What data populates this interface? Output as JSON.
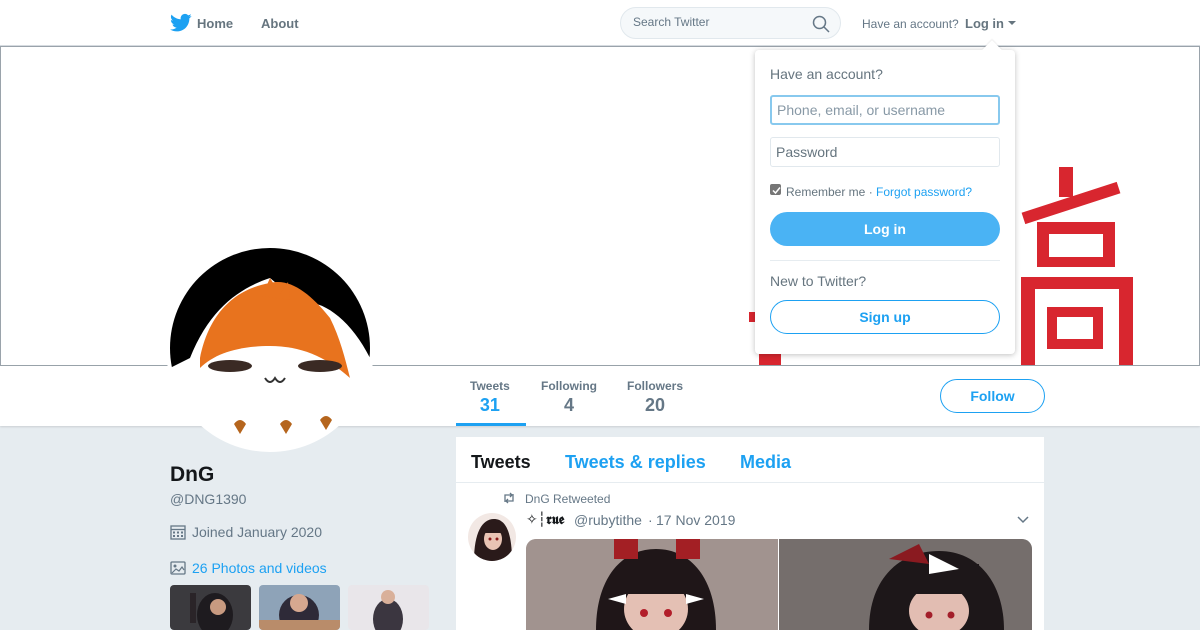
{
  "topnav": {
    "logo_icon": "twitter-bird-icon",
    "home_label": "Home",
    "about_label": "About",
    "search_placeholder": "Search Twitter",
    "search_icon": "search-icon",
    "have_account": "Have an account?",
    "login_label": "Log in"
  },
  "profile": {
    "name": "DnG",
    "handle": "@DNG1390",
    "joined": "Joined January 2020",
    "photos_label": "26 Photos and videos",
    "follow_label": "Follow"
  },
  "stats": [
    {
      "label": "Tweets",
      "value": "31"
    },
    {
      "label": "Following",
      "value": "4"
    },
    {
      "label": "Followers",
      "value": "20"
    }
  ],
  "timeline": {
    "tabs": [
      "Tweets",
      "Tweets & replies",
      "Media"
    ],
    "tweet": {
      "retweet_text": "DnG Retweeted",
      "author": "✧┆𝖗𝖚𝖊",
      "handle": "@rubytithe",
      "separator": "·",
      "date": "17 Nov 2019"
    }
  },
  "login_dropdown": {
    "title": "Have an account?",
    "username_placeholder": "Phone, email, or username",
    "password_placeholder": "Password",
    "remember_me": "Remember me",
    "separator": " · ",
    "forgot_password": "Forgot password?",
    "login_button": "Log in",
    "new_to_twitter": "New to Twitter?",
    "signup_button": "Sign up"
  },
  "colors": {
    "accent": "#1da1f2",
    "button_fill": "#4ab3f4",
    "page_bg": "#e6ecf0",
    "text_muted": "#657786"
  }
}
